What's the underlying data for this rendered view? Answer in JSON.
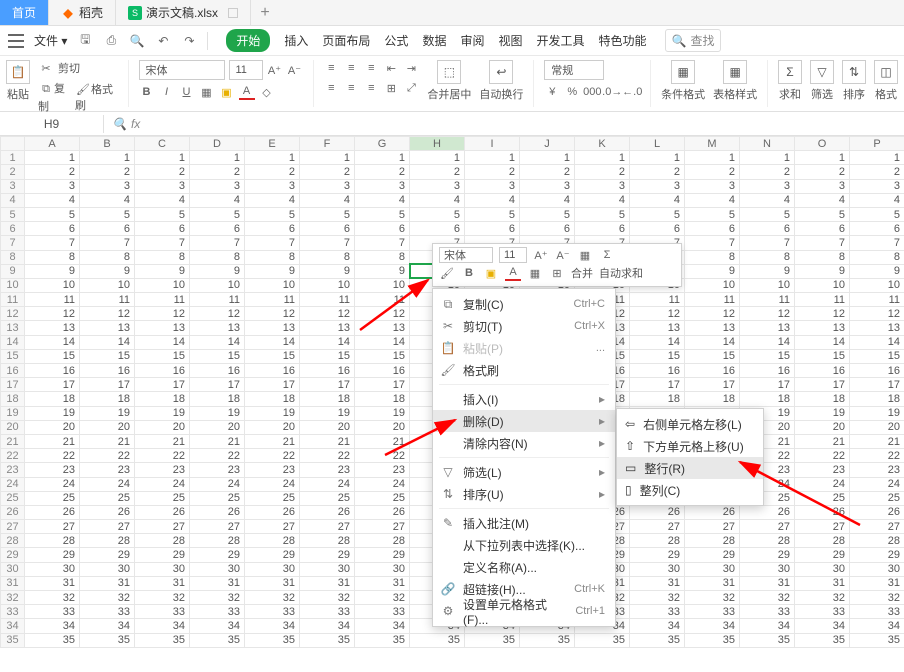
{
  "tabs": {
    "home": "首页",
    "docshell": "稻壳",
    "doc": "演示文稿.xlsx",
    "new": "+"
  },
  "menubar": {
    "file": "文件",
    "items": [
      "开始",
      "插入",
      "页面布局",
      "公式",
      "数据",
      "审阅",
      "视图",
      "开发工具",
      "特色功能"
    ],
    "search": "查找"
  },
  "ribbon": {
    "paste": "粘贴",
    "cut": "剪切",
    "copy": "复制",
    "formatpainter": "格式刷",
    "font_name": "宋体",
    "font_size": "11",
    "mergecenter": "合并居中",
    "wrap": "自动换行",
    "numfmt": "常规",
    "condfmt": "条件格式",
    "cellstyle": "表格样式",
    "sum": "求和",
    "filter": "筛选",
    "sort": "排序",
    "format": "格式"
  },
  "fxbar": {
    "cell": "H9"
  },
  "sheet": {
    "cols": [
      "A",
      "B",
      "C",
      "D",
      "E",
      "F",
      "G",
      "H",
      "I",
      "J",
      "K",
      "L",
      "M",
      "N",
      "O",
      "P"
    ],
    "active_col": "H",
    "active_row": 9,
    "rows": 35
  },
  "mini": {
    "font_name": "宋体",
    "font_size": "11",
    "merge": "合并",
    "autosum": "自动求和"
  },
  "ctx": {
    "copy": "复制(C)",
    "cut": "剪切(T)",
    "paste": "粘贴(P)",
    "formatpainter": "格式刷",
    "insert": "插入(I)",
    "delete": "删除(D)",
    "clear": "清除内容(N)",
    "filter": "筛选(L)",
    "sortu": "排序(U)",
    "comment": "插入批注(M)",
    "picklist": "从下拉列表中选择(K)...",
    "defname": "定义名称(A)...",
    "hyperlink": "超链接(H)...",
    "cellfmt": "设置单元格格式(F)...",
    "sc_copy": "Ctrl+C",
    "sc_cut": "Ctrl+X",
    "sc_link": "Ctrl+K",
    "sc_fmt": "Ctrl+1",
    "ellipsis": "..."
  },
  "submenu": {
    "shiftleft": "右侧单元格左移(L)",
    "shiftup": "下方单元格上移(U)",
    "row": "整行(R)",
    "col": "整列(C)"
  }
}
